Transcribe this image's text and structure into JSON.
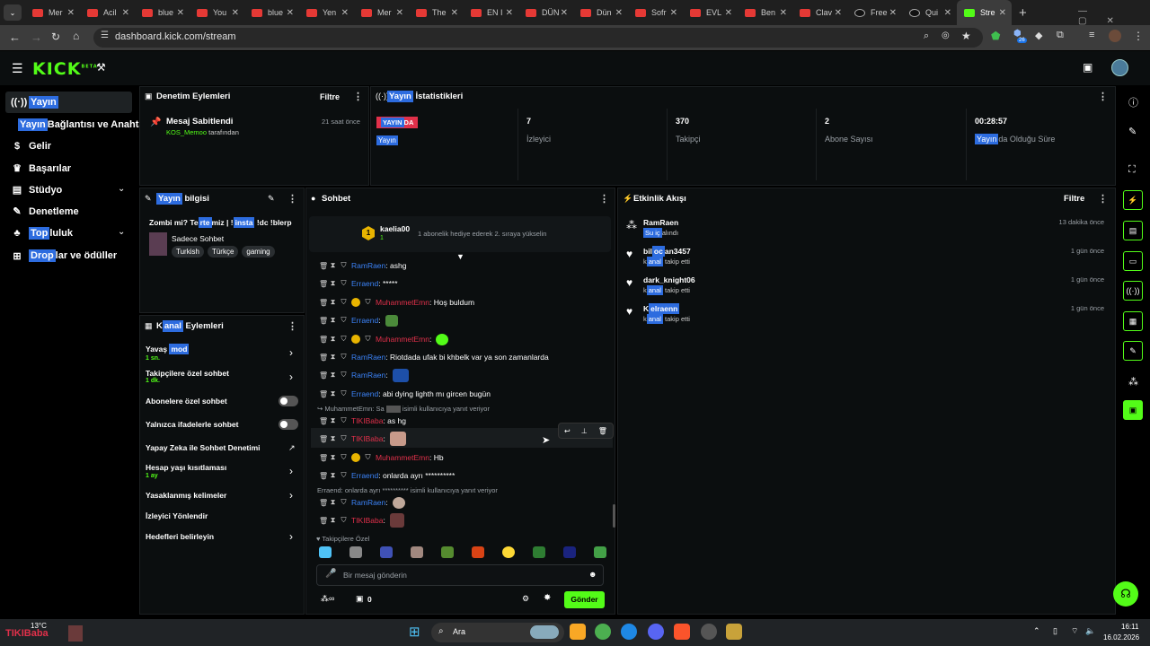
{
  "browser": {
    "tabs": [
      {
        "label": "Mer"
      },
      {
        "label": "Acil"
      },
      {
        "label": "blue"
      },
      {
        "label": "You"
      },
      {
        "label": "blue"
      },
      {
        "label": "Yen"
      },
      {
        "label": "Mer"
      },
      {
        "label": "The"
      },
      {
        "label": "EN I"
      },
      {
        "label": "DÜN"
      },
      {
        "label": "Dün"
      },
      {
        "label": "Sofr"
      },
      {
        "label": "EVL"
      },
      {
        "label": "Ben"
      },
      {
        "label": "Clav"
      },
      {
        "label": "Free"
      },
      {
        "label": "Qui"
      },
      {
        "label": "Stre"
      }
    ],
    "url": "dashboard.kick.com/stream",
    "ext_badge": "26"
  },
  "kick": {
    "logo": "KICK",
    "logo_sup": "BETA"
  },
  "sidebar": {
    "items": [
      {
        "label_hl": "Yayın",
        "label": ""
      },
      {
        "label_hl": "Yayın",
        "label": " Bağlantısı ve Anahtar"
      },
      {
        "label_hl": "",
        "label": "Gelir"
      },
      {
        "label_hl": "",
        "label": "Başarılar"
      },
      {
        "label_hl": "",
        "label": "Stüdyo"
      },
      {
        "label_hl": "",
        "label": "Denetleme"
      },
      {
        "label_hl": "Top",
        "label": "luluk"
      },
      {
        "label_hl": "Drop",
        "label": "lar ve ödüller"
      }
    ]
  },
  "moderation": {
    "title": "Denetim Eylemleri",
    "filter": "Filtre",
    "item_title": "Mesaj Sabitlendi",
    "item_time": "21 saat önce",
    "item_user": "KOS_Memoo",
    "item_suffix": " tarafından"
  },
  "stats": {
    "title_hl": "Yayın",
    "title": " İstatistikleri",
    "live_badge_hl": "YAYIN",
    "live_badge": "DA",
    "live_sub": "Yayın",
    "cells": [
      {
        "value": "7",
        "label": "İzleyici"
      },
      {
        "value": "370",
        "label": "Takipçi"
      },
      {
        "value": "2",
        "label": "Abone Sayısı"
      },
      {
        "value": "00:28:57",
        "label_hl": "Yayın",
        "label": "da Olduğu Süre"
      }
    ]
  },
  "streaminfo": {
    "title_hl": "Yayın",
    "title": " bilgisi",
    "stream_title_a": "Zombi mi? Te",
    "stream_title_hl1": "rte",
    "stream_title_b": "miz | !",
    "stream_title_hl2": "insta",
    "stream_title_c": " !dc !blerp",
    "category": "Sadece Sohbet",
    "tags": [
      "Turkish",
      "Türkçe",
      "gaming"
    ]
  },
  "channel_actions": {
    "title_a": "K",
    "title_hl": "anal",
    "title_b": " Eylemleri",
    "items": [
      {
        "label": "Yavaş ",
        "label_hl": "mod",
        "sub": "1 sn."
      },
      {
        "label": "Takipçilere özel sohbet",
        "label_hl": "",
        "sub": "1 dk."
      },
      {
        "label": "Abonelere özel sohbet",
        "label_hl": "",
        "sub": ""
      },
      {
        "label": "Yalnızca ifadelerle sohbet",
        "label_hl": "",
        "sub": ""
      },
      {
        "label": "Yapay Zeka ile Sohbet Denetimi",
        "label_hl": "",
        "sub": ""
      },
      {
        "label": "Hesap yaşı kısıtlaması",
        "label_hl": "",
        "sub": "1 ay"
      },
      {
        "label": "Yasaklanmış kelimeler",
        "label_hl": "",
        "sub": ""
      },
      {
        "label": "İzleyici Yönlendir",
        "label_hl": "",
        "sub": ""
      },
      {
        "label": "Hedefleri belirleyin",
        "label_hl": "",
        "sub": ""
      }
    ]
  },
  "chat": {
    "title": "Sohbet",
    "pinned_user": "kaelia00",
    "pinned_text": "1 abonelik hediye ederek 2. sıraya yükselin",
    "pinned_count": "1",
    "messages": [
      {
        "user": "RamRaen",
        "text": ": ashg"
      },
      {
        "user": "Erraend",
        "text": ": *****"
      },
      {
        "user": "MuhammetEmn",
        "text": ": Hoş buldum"
      },
      {
        "user": "Erraend",
        "text": ":"
      },
      {
        "user": "MuhammetEmn",
        "text": ":"
      },
      {
        "user": "RamRaen",
        "text": ": Riotdada ufak bi khbelk var ya son zamanlarda"
      },
      {
        "user": "RamRaen",
        "text": ":"
      },
      {
        "user": "Erraend",
        "text": ": abi dying lighth mı gircen bugün"
      },
      {
        "user": "TIKIBaba",
        "text": ": as hg"
      },
      {
        "user": "TIKIBaba",
        "text": ":"
      },
      {
        "user": "MuhammetEmn",
        "text": ": Hb"
      },
      {
        "user": "Erraend",
        "text": ": onlarda ayrı **********"
      },
      {
        "user": "RamRaen",
        "text": ":"
      },
      {
        "user": "TIKIBaba",
        "text": ":"
      }
    ],
    "reply1": "MuhammetEmn: Sa",
    "reply1_suffix": " isimli kullanıcıya yanıt veriyor",
    "reply2": "Erraend: onlarda ayrı ********** isimli kullanıcıya yanıt veriyor",
    "followers_only": "Takipçilere Özel",
    "input_placeholder": "Bir mesaj gönderin",
    "points": "0",
    "send": "Gönder"
  },
  "activity": {
    "title": "Etkinlik Akışı",
    "filter": "Filtre",
    "events": [
      {
        "user": "RamRaen",
        "sub_hl": "Su iç",
        "sub": "alındı",
        "time": "13 dakika önce"
      },
      {
        "user_a": "bil",
        "user_hl": "oc",
        "user_b": "an3457",
        "sub_a": "k",
        "sub_hl": "anal",
        "sub": " takip etti",
        "time": "1 gün önce"
      },
      {
        "user": "dark_knight06",
        "sub_a": "k",
        "sub_hl": "anal",
        "sub": " takip etti",
        "time": "1 gün önce"
      },
      {
        "user_a": "K",
        "user_hl": "elraenn",
        "user_b": "",
        "sub_a": "k",
        "sub_hl": "anal",
        "sub": " takip etti",
        "time": "1 gün önce"
      }
    ]
  },
  "taskbar": {
    "weather": "13°C",
    "weather_user": "TIKIBaba",
    "search": "Ara",
    "time": "16:11",
    "date": "16.02.2026"
  },
  "colors": {
    "accent": "#53fc18",
    "highlight": "#2d6cdf",
    "live": "#e0304a"
  }
}
